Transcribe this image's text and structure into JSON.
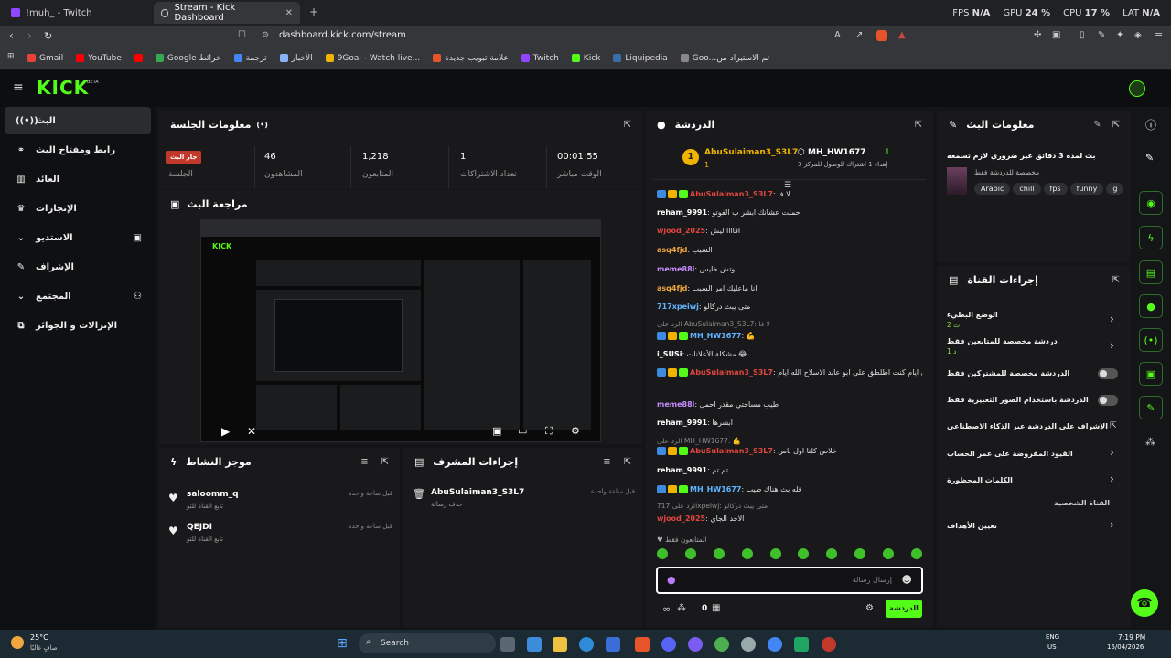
{
  "tabs": [
    {
      "title": "!muh_ - Twitch"
    },
    {
      "title": "Stream - Kick Dashboard"
    }
  ],
  "perf": {
    "fps_label": "FPS",
    "fps": "N/A",
    "gpu_label": "GPU",
    "gpu": "24 %",
    "cpu_label": "CPU",
    "cpu": "17 %",
    "lat_label": "LAT",
    "lat": "N/A"
  },
  "address": "dashboard.kick.com/stream",
  "bookmarks": [
    "Gmail",
    "YouTube",
    "Google خرائط",
    "ترجمة",
    "الأخبار",
    "9Goal - Watch live...",
    "علامة تبويب جديدة",
    "Twitch",
    "Kick",
    "Liquipedia",
    "Goo...تم الاستيراد من"
  ],
  "brand": {
    "logo": "KICK",
    "beta": "BETA"
  },
  "sidebar": [
    {
      "label": "البث",
      "icon": "broadcast-icon"
    },
    {
      "label": "رابط ومفتاح البث",
      "icon": "link-icon"
    },
    {
      "label": "العائد",
      "icon": "chart-icon"
    },
    {
      "label": "الإنجازات",
      "icon": "trophy-icon"
    },
    {
      "label": "الاستديو",
      "icon": "studio-icon"
    },
    {
      "label": "الإشراف",
      "icon": "wrench-icon"
    },
    {
      "label": "المجتمع",
      "icon": "community-icon"
    },
    {
      "label": "الإنزالات و الجوائز",
      "icon": "gift-icon"
    }
  ],
  "session": {
    "title": "معلومات الجلسة",
    "live_badge": "جار البث",
    "session_label": "الجلسة",
    "stats": [
      {
        "value": "46",
        "label": "المشاهدون"
      },
      {
        "value": "1,218",
        "label": "المتابعون"
      },
      {
        "value": "1",
        "label": "تعداد الاشتراكات"
      },
      {
        "value": "00:01:55",
        "label": "الوقت مباشر"
      }
    ]
  },
  "preview": {
    "title": "مراجعة البث"
  },
  "activity": {
    "title": "موجز النشاط",
    "items": [
      {
        "user": "saloomm_q",
        "action": "تابع القناة للتو",
        "time": "قبل ساعة واحدة"
      },
      {
        "user": "QEJDI",
        "action": "تابع القناة للتو",
        "time": "قبل ساعة واحدة"
      }
    ]
  },
  "modactions": {
    "title": "إجراءات المشرف",
    "items": [
      {
        "user": "AbuSulaiman3_S3L7",
        "action": "حذف رسالة",
        "time": "قبل ساعة واحدة"
      }
    ]
  },
  "chat": {
    "title": "الدردشة",
    "top_gifter": "AbuSulaiman3_S3L7",
    "top_rank": "1",
    "top_count": "1",
    "second_gifter": "MH_HW1677",
    "second_count": "1",
    "gift_note": "إهداء 1 اشتراك للوصول للمركز 3",
    "messages": [
      {
        "user": "AbuSulaiman3_S3L7",
        "cls": "u-red",
        "text": "لا فا",
        "badges": true
      },
      {
        "user": "reham_9991",
        "cls": "u-white",
        "text": "حملت عشانك ابشر ب الفوتو"
      },
      {
        "user": "wjood_2025",
        "cls": "u-red",
        "text": "افاااا ليش"
      },
      {
        "user": "asq4fjd",
        "cls": "u-orange",
        "text": "السبب"
      },
      {
        "user": "meme88i",
        "cls": "u-purple",
        "text": "اوتش خايس"
      },
      {
        "user": "asq4fjd",
        "cls": "u-orange",
        "text": "انا ماعليك امر السبب"
      },
      {
        "user": "717xpeiwj",
        "cls": "u-blue",
        "text": "متى يبث دركالو"
      },
      {
        "reply": "الرد على AbuSulaiman3_S3L7: لا فا"
      },
      {
        "user": "MH_HW1677",
        "cls": "u-blue",
        "text": "💪",
        "badges": true
      },
      {
        "user": "i_SUSi",
        "cls": "u-white",
        "text": "مشكلة الأعلانات 😂"
      },
      {
        "user": "AbuSulaiman3_S3L7",
        "cls": "u-red",
        "text": "يوه ذكرتني ايام كنت اطلطق على ابو عابد الاسلاح الله ايام",
        "badges": true
      },
      {
        "user": "meme88i",
        "cls": "u-purple",
        "text": "طيب مساحتي مقدر احمل"
      },
      {
        "user": "reham_9991",
        "cls": "u-white",
        "text": "ابشرها"
      },
      {
        "reply": "الرد على MH_HW1677: 💪"
      },
      {
        "user": "AbuSulaiman3_S3L7",
        "cls": "u-red",
        "text": "خلاص كلنا اول ناس",
        "badges": true
      },
      {
        "user": "reham_9991",
        "cls": "u-white",
        "text": "تم تم"
      },
      {
        "user": "MH_HW1677",
        "cls": "u-blue",
        "text": "قله بث هناك طيب",
        "badges": true
      },
      {
        "reply": "الرد على 717xpeiwj: متى يبث دركالو"
      },
      {
        "user": "wjood_2025",
        "cls": "u-red",
        "text": "الاحد الجاي"
      }
    ],
    "followers_only": "المتابعون فقط",
    "input_placeholder": "إرسال رسالة",
    "send_label": "الدردشة",
    "points": "0"
  },
  "streaminfo": {
    "title": "معلومات البث",
    "stream_title": "بث لمدة 3 دقائق غير ضروري لازم تسمعه",
    "category": "مخصصة للدردشة فقط",
    "tags": [
      "Arabic",
      "chill",
      "fps",
      "funny",
      "g"
    ]
  },
  "channel": {
    "title": "إجراءات القناة",
    "slow_mode": "الوضع البطيء",
    "slow_value": "2 ث",
    "followers_chat": "دردشة مخصصة للمتابعين فقط",
    "followers_value": "1 د",
    "subs_chat": "الدردشة مخصصة للمشتركين فقط",
    "emote_chat": "الدردشة باستخدام الصور التعبيرية فقط",
    "ai_mod": "الإشراف على الدردشة عبر الذكاء الاصطناعي",
    "age_limits": "القيود المفروضة على عمر الحساب",
    "banned_words": "الكلمات المحظورة",
    "private_channel": "القناة الشخصية",
    "goals": "تعيين الأهداف"
  },
  "taskbar": {
    "weather_temp": "25°C",
    "weather_desc": "صافٍ غالبًا",
    "search": "Search",
    "lang": "ENG",
    "region": "US",
    "time": "7:19 PM",
    "date": "15/04/2026"
  },
  "colors": {
    "brand": "#53fc18",
    "live": "#c0392b",
    "panel": "#19191b"
  }
}
